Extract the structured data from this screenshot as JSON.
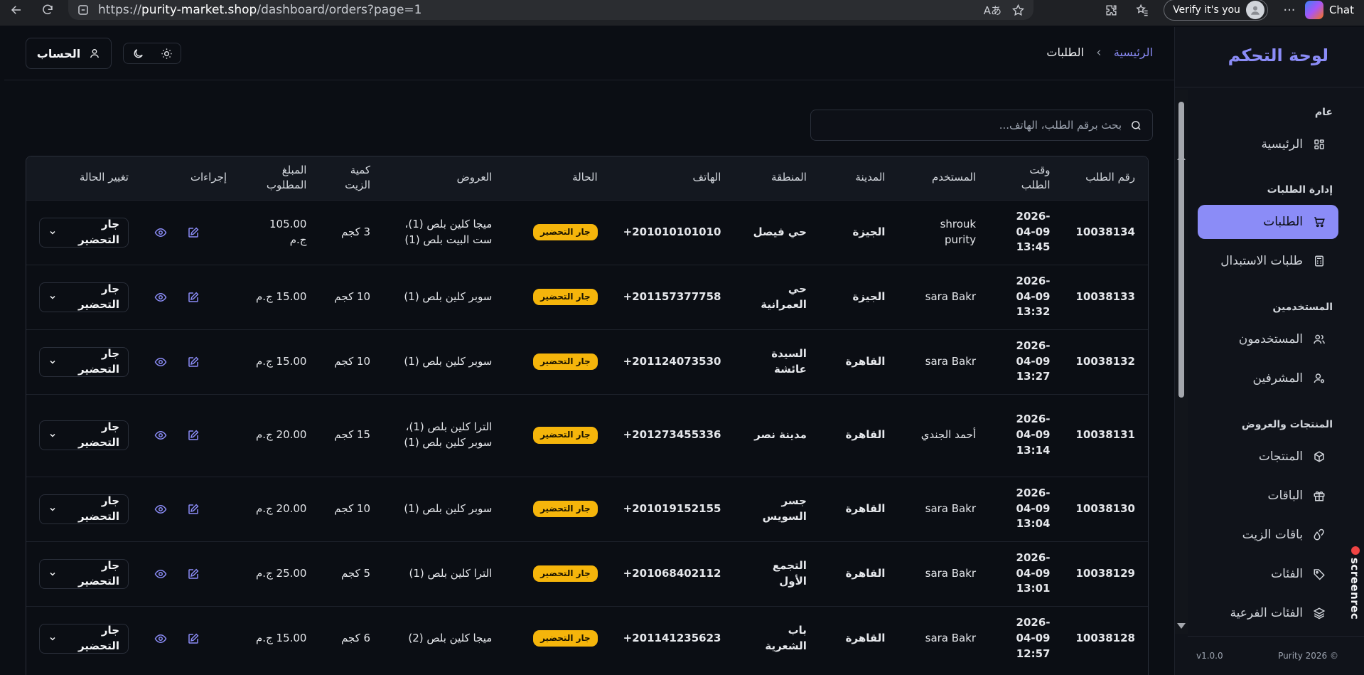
{
  "browser": {
    "url_prefix": "https://",
    "url_host": "purity-market.shop",
    "url_path": "/dashboard/orders?page=1",
    "verify_label": "Verify it's you",
    "chat_label": "Chat"
  },
  "sidebar": {
    "title": "لوحة التحكم",
    "sections": {
      "general": "عام",
      "orders": "إدارة الطلبات",
      "users": "المستخدمين",
      "products": "المنتجات والعروض"
    },
    "items": {
      "home": "الرئيسية",
      "orders": "الطلبات",
      "exchange": "طلبات الاستبدال",
      "users": "المستخدمون",
      "supervisors": "المشرفين",
      "products": "المنتجات",
      "packages": "الباقات",
      "oil_packages": "باقات الزيت",
      "categories": "الفئات",
      "subcategories": "الفئات الفرعية"
    },
    "footer_copyright": "Purity 2026 ©",
    "footer_version": "v1.0.0"
  },
  "topbar": {
    "breadcrumb_home": "الرئيسية",
    "breadcrumb_current": "الطلبات",
    "account_label": "الحساب"
  },
  "search": {
    "placeholder": "بحث برقم الطلب، الهاتف..."
  },
  "table": {
    "headers": {
      "order_id": "رقم الطلب",
      "order_time": "وقت الطلب",
      "user": "المستخدم",
      "city": "المدينة",
      "area": "المنطقة",
      "phone": "الهاتف",
      "status": "الحالة",
      "offers": "العروض",
      "oil_qty": "كمية الزيت",
      "amount": "المبلغ المطلوب",
      "actions": "إجراءات",
      "change_status": "تغيير الحالة"
    },
    "rows": [
      {
        "id": "10038134",
        "date": "2026-04-09",
        "time": "13:45",
        "user": "shrouk purity",
        "city": "الجيزة",
        "area": "حي فيصل",
        "phone": "+201010101010",
        "status": "جار التحضير",
        "offers": "ميجا كلين بلص (1)، ست البيت بلص (1)",
        "qty": "3 كجم",
        "amount": "105.00 ج.م",
        "select": "جار التحضير"
      },
      {
        "id": "10038133",
        "date": "2026-04-09",
        "time": "13:32",
        "user": "sara Bakr",
        "city": "الجيزة",
        "area": "حي العمرانية",
        "phone": "+201157377758",
        "status": "جار التحضير",
        "offers": "سوبر كلين بلص (1)",
        "qty": "10 كجم",
        "amount": "15.00 ج.م",
        "select": "جار التحضير"
      },
      {
        "id": "10038132",
        "date": "2026-04-09",
        "time": "13:27",
        "user": "sara Bakr",
        "city": "القاهرة",
        "area": "السيدة عائشة",
        "phone": "+201124073530",
        "status": "جار التحضير",
        "offers": "سوبر كلين بلص (1)",
        "qty": "10 كجم",
        "amount": "15.00 ج.م",
        "select": "جار التحضير"
      },
      {
        "id": "10038131",
        "date": "2026-04-09",
        "time": "13:14",
        "user": "أحمد الجندي",
        "city": "القاهرة",
        "area": "مدينة نصر",
        "phone": "+201273455336",
        "status": "جار التحضير",
        "offers": "الترا كلين بلص (1)، سوبر كلين بلص (1)",
        "qty": "15 كجم",
        "amount": "20.00 ج.م",
        "select": "جار التحضير"
      },
      {
        "id": "10038130",
        "date": "2026-04-09",
        "time": "13:04",
        "user": "sara Bakr",
        "city": "القاهرة",
        "area": "جسر السويس",
        "phone": "+201019152155",
        "status": "جار التحضير",
        "offers": "سوبر كلين بلص (1)",
        "qty": "10 كجم",
        "amount": "20.00 ج.م",
        "select": "جار التحضير"
      },
      {
        "id": "10038129",
        "date": "2026-04-09",
        "time": "13:01",
        "user": "sara Bakr",
        "city": "القاهرة",
        "area": "التجمع الأول",
        "phone": "+201068402112",
        "status": "جار التحضير",
        "offers": "الترا كلين بلص (1)",
        "qty": "5 كجم",
        "amount": "25.00 ج.م",
        "select": "جار التحضير"
      },
      {
        "id": "10038128",
        "date": "2026-04-09",
        "time": "12:57",
        "user": "sara Bakr",
        "city": "القاهرة",
        "area": "باب الشعرية",
        "phone": "+201141235623",
        "status": "جار التحضير",
        "offers": "ميجا كلين بلص (2)",
        "qty": "6 كجم",
        "amount": "15.00 ج.م",
        "select": "جار التحضير"
      }
    ]
  },
  "overlay": {
    "screenrec_label": "screenrec"
  },
  "colors": {
    "accent": "#8b8cf7",
    "status_badge": "#f5b50b",
    "background": "#0b0e14",
    "sidebar_bg": "#10131a"
  }
}
